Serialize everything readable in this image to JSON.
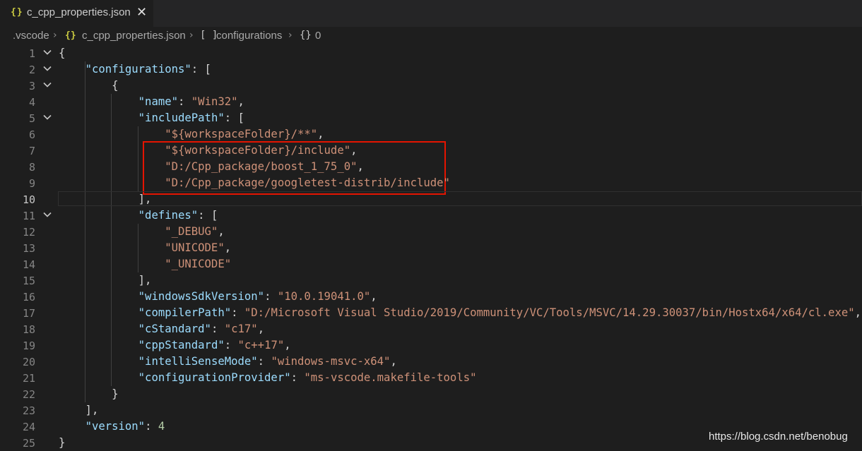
{
  "tab": {
    "icon": "{}",
    "title": "c_cpp_properties.json",
    "close": "✕"
  },
  "breadcrumb": {
    "items": [
      ".vscode",
      "c_cpp_properties.json",
      "configurations",
      "0"
    ],
    "icons": [
      "json-file-icon",
      "array-icon",
      "object-icon"
    ]
  },
  "editor": {
    "active_line": 10,
    "lines": [
      {
        "n": "1",
        "tokens": [
          [
            "p",
            "{"
          ]
        ]
      },
      {
        "n": "2",
        "tokens": [
          [
            "p",
            "    "
          ],
          [
            "k",
            "\"configurations\""
          ],
          [
            "p",
            ": ["
          ]
        ]
      },
      {
        "n": "3",
        "tokens": [
          [
            "p",
            "        {"
          ]
        ]
      },
      {
        "n": "4",
        "tokens": [
          [
            "p",
            "            "
          ],
          [
            "k",
            "\"name\""
          ],
          [
            "p",
            ": "
          ],
          [
            "s",
            "\"Win32\""
          ],
          [
            "p",
            ","
          ]
        ]
      },
      {
        "n": "5",
        "tokens": [
          [
            "p",
            "            "
          ],
          [
            "k",
            "\"includePath\""
          ],
          [
            "p",
            ": ["
          ]
        ]
      },
      {
        "n": "6",
        "tokens": [
          [
            "p",
            "                "
          ],
          [
            "s",
            "\"${workspaceFolder}/**\""
          ],
          [
            "p",
            ","
          ]
        ]
      },
      {
        "n": "7",
        "tokens": [
          [
            "p",
            "                "
          ],
          [
            "s",
            "\"${workspaceFolder}/include\""
          ],
          [
            "p",
            ","
          ]
        ]
      },
      {
        "n": "8",
        "tokens": [
          [
            "p",
            "                "
          ],
          [
            "s",
            "\"D:/Cpp_package/boost_1_75_0\""
          ],
          [
            "p",
            ","
          ]
        ]
      },
      {
        "n": "9",
        "tokens": [
          [
            "p",
            "                "
          ],
          [
            "s",
            "\"D:/Cpp_package/googletest-distrib/include\""
          ]
        ]
      },
      {
        "n": "10",
        "tokens": [
          [
            "p",
            "            ],"
          ]
        ]
      },
      {
        "n": "11",
        "tokens": [
          [
            "p",
            "            "
          ],
          [
            "k",
            "\"defines\""
          ],
          [
            "p",
            ": ["
          ]
        ]
      },
      {
        "n": "12",
        "tokens": [
          [
            "p",
            "                "
          ],
          [
            "s",
            "\"_DEBUG\""
          ],
          [
            "p",
            ","
          ]
        ]
      },
      {
        "n": "13",
        "tokens": [
          [
            "p",
            "                "
          ],
          [
            "s",
            "\"UNICODE\""
          ],
          [
            "p",
            ","
          ]
        ]
      },
      {
        "n": "14",
        "tokens": [
          [
            "p",
            "                "
          ],
          [
            "s",
            "\"_UNICODE\""
          ]
        ]
      },
      {
        "n": "15",
        "tokens": [
          [
            "p",
            "            ],"
          ]
        ]
      },
      {
        "n": "16",
        "tokens": [
          [
            "p",
            "            "
          ],
          [
            "k",
            "\"windowsSdkVersion\""
          ],
          [
            "p",
            ": "
          ],
          [
            "s",
            "\"10.0.19041.0\""
          ],
          [
            "p",
            ","
          ]
        ]
      },
      {
        "n": "17",
        "tokens": [
          [
            "p",
            "            "
          ],
          [
            "k",
            "\"compilerPath\""
          ],
          [
            "p",
            ": "
          ],
          [
            "s",
            "\"D:/Microsoft Visual Studio/2019/Community/VC/Tools/MSVC/14.29.30037/bin/Hostx64/x64/cl.exe\""
          ],
          [
            "p",
            ","
          ]
        ]
      },
      {
        "n": "18",
        "tokens": [
          [
            "p",
            "            "
          ],
          [
            "k",
            "\"cStandard\""
          ],
          [
            "p",
            ": "
          ],
          [
            "s",
            "\"c17\""
          ],
          [
            "p",
            ","
          ]
        ]
      },
      {
        "n": "19",
        "tokens": [
          [
            "p",
            "            "
          ],
          [
            "k",
            "\"cppStandard\""
          ],
          [
            "p",
            ": "
          ],
          [
            "s",
            "\"c++17\""
          ],
          [
            "p",
            ","
          ]
        ]
      },
      {
        "n": "20",
        "tokens": [
          [
            "p",
            "            "
          ],
          [
            "k",
            "\"intelliSenseMode\""
          ],
          [
            "p",
            ": "
          ],
          [
            "s",
            "\"windows-msvc-x64\""
          ],
          [
            "p",
            ","
          ]
        ]
      },
      {
        "n": "21",
        "tokens": [
          [
            "p",
            "            "
          ],
          [
            "k",
            "\"configurationProvider\""
          ],
          [
            "p",
            ": "
          ],
          [
            "s",
            "\"ms-vscode.makefile-tools\""
          ]
        ]
      },
      {
        "n": "22",
        "tokens": [
          [
            "p",
            "        }"
          ]
        ]
      },
      {
        "n": "23",
        "tokens": [
          [
            "p",
            "    ],"
          ]
        ]
      },
      {
        "n": "24",
        "tokens": [
          [
            "p",
            "    "
          ],
          [
            "k",
            "\"version\""
          ],
          [
            "p",
            ": "
          ],
          [
            "n",
            "4"
          ]
        ]
      },
      {
        "n": "25",
        "tokens": [
          [
            "p",
            "}"
          ]
        ]
      }
    ],
    "foldable_lines": [
      "1",
      "2",
      "3",
      "5",
      "11"
    ]
  },
  "watermark": "https://blog.csdn.net/benobug",
  "colors": {
    "background": "#1e1e1e",
    "key": "#9cdcfe",
    "string": "#ce9178",
    "number": "#b5cea8",
    "highlight_box": "#e51400"
  }
}
